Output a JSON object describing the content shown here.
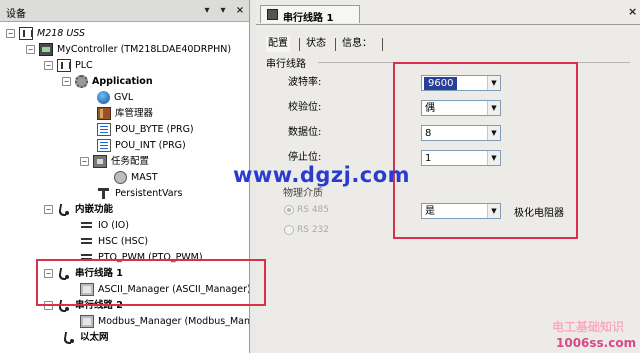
{
  "left_panel": {
    "title": "设备",
    "dropdown_glyph": "▾",
    "pin_glyph": "▾",
    "close_glyph": "×",
    "tree": [
      {
        "label": "M218 USS",
        "icon": "project-icon",
        "expander": "−"
      },
      {
        "label": "MyController (TM218LDAE40DRPHN)",
        "icon": "controller-icon",
        "expander": "−"
      },
      {
        "label": "PLC",
        "icon": "plc-icon",
        "expander": "−"
      },
      {
        "label": "Application",
        "icon": "application-icon",
        "expander": "−"
      },
      {
        "label": "GVL",
        "icon": "gvl-icon"
      },
      {
        "label": "库管理器",
        "icon": "library-manager-icon"
      },
      {
        "label": "POU_BYTE (PRG)",
        "icon": "pou-icon"
      },
      {
        "label": "POU_INT (PRG)",
        "icon": "pou-icon"
      },
      {
        "label": "任务配置",
        "icon": "task-config-icon",
        "expander": "−"
      },
      {
        "label": "MAST",
        "icon": "task-icon"
      },
      {
        "label": "PersistentVars",
        "icon": "persistent-vars-icon"
      },
      {
        "label": "内嵌功能",
        "icon": "connector-icon",
        "expander": "−"
      },
      {
        "label": "IO (IO)",
        "icon": "io-icon"
      },
      {
        "label": "HSC (HSC)",
        "icon": "hsc-icon"
      },
      {
        "label": "PTO_PWM (PTO_PWM)",
        "icon": "pto-pwm-icon"
      },
      {
        "label": "串行线路 1",
        "icon": "serial-line-icon",
        "expander": "−"
      },
      {
        "label": "ASCII_Manager (ASCII_Manager)",
        "icon": "ascii-manager-icon"
      },
      {
        "label": "串行线路 2",
        "icon": "serial-line-icon",
        "expander": "−"
      },
      {
        "label": "Modbus_Manager (Modbus_Manager)",
        "icon": "modbus-manager-icon"
      },
      {
        "label": "以太网",
        "icon": "ethernet-icon"
      }
    ]
  },
  "editor": {
    "tab_label": "串行线路 1",
    "close_glyph": "×",
    "sub_tabs": [
      "配置",
      "状态",
      "信息："
    ],
    "group_title": "串行线路",
    "fields": [
      {
        "label": "波特率:",
        "value": "9600",
        "highlighted": true
      },
      {
        "label": "校验位:",
        "value": "偶"
      },
      {
        "label": "数据位:",
        "value": "8"
      },
      {
        "label": "停止位:",
        "value": "1"
      }
    ],
    "physical_medium_title": "物理介质",
    "radio_options": [
      {
        "label": "RS 485",
        "selected": true
      },
      {
        "label": "RS 232",
        "selected": false
      }
    ],
    "polarization": {
      "value": "是",
      "label": "极化电阻器"
    }
  },
  "overlays": {
    "watermark": "www.dgzj.com",
    "brand_line_1": "电工基础知识",
    "brand_line_2": "1006ss.com",
    "highlight_color": "#d8324a"
  }
}
